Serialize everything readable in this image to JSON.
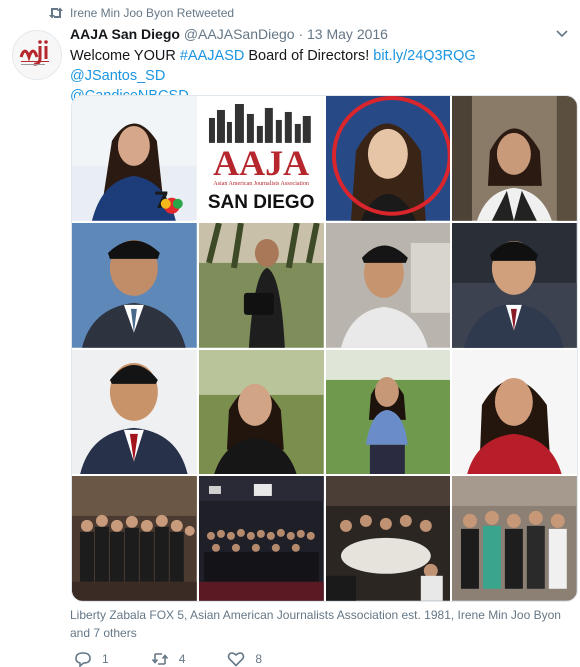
{
  "retweet_line": "Irene Min Joo Byon Retweeted",
  "tweet": {
    "display_name": "AAJA San Diego",
    "handle": "@AAJASanDiego",
    "separator": " · ",
    "date": "13 May 2016",
    "text_parts": {
      "p1": "Welcome YOUR ",
      "hashtag": "#AAJASD",
      "p2": " Board of Directors! ",
      "link": "bit.ly/24Q3RQG",
      "mention1": "@JSantos_SD",
      "mention2": "@CandiceNBCSD"
    },
    "avatar_logo_text": "mji",
    "avatar_sub_text": "San Diego"
  },
  "media": {
    "tile_aaja_logo": "AAJA",
    "tile_aaja_sub": "Asian American Journalists Association",
    "tile_aaja_city": "SAN DIEGO"
  },
  "caption": "Liberty Zabala FOX 5, Asian American Journalists Association est. 1981, Irene Min Joo Byon and 7 others",
  "actions": {
    "reply_count": "1",
    "retweet_count": "4",
    "like_count": "8"
  },
  "colors": {
    "link": "#1b95e0",
    "secondary_text": "#657786",
    "highlight_circle": "#d9252b",
    "logo_red": "#b5272d"
  }
}
